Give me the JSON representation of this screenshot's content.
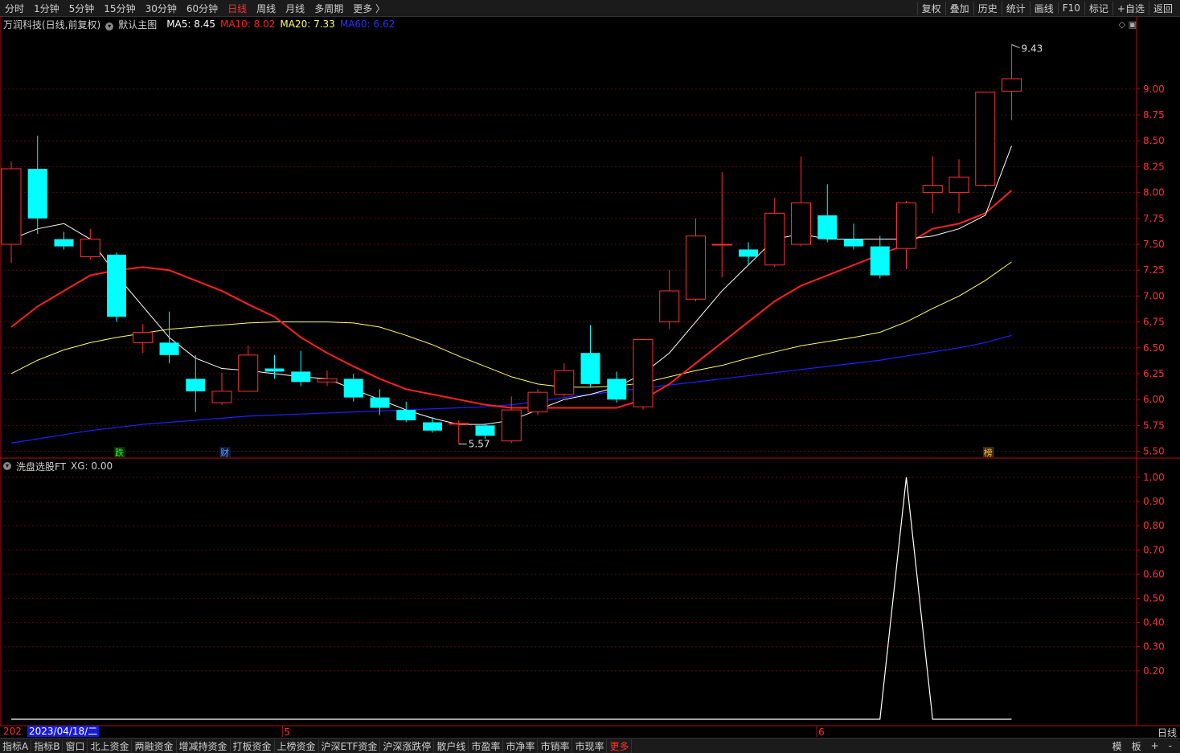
{
  "topbar": {
    "periods": [
      "分时",
      "1分钟",
      "5分钟",
      "15分钟",
      "30分钟",
      "60分钟",
      "日线",
      "周线",
      "月线",
      "多周期",
      "更多 〉"
    ],
    "active_period": "日线",
    "tools": [
      "复权",
      "叠加",
      "历史",
      "统计",
      "画线",
      "F10",
      "标记",
      "+自选",
      "返回"
    ]
  },
  "info": {
    "stock": "万润科技(日线,前复权)",
    "main_chart": "默认主图",
    "ma5": "MA5: 8.45",
    "ma10": "MA10: 8.02",
    "ma20": "MA20: 7.33",
    "ma60": "MA60: 6.62",
    "colors": {
      "ma5": "#ffffff",
      "ma10": "#ff2020",
      "ma20": "#ffff66",
      "ma60": "#2020ff",
      "up": "#ff3030",
      "down": "#00ffff"
    }
  },
  "sub": {
    "title": "洗盘选股FT",
    "xg": "XG: 0.00"
  },
  "markers": {
    "die": "跌",
    "cai": "财",
    "bang": "榜"
  },
  "chart_data": {
    "type": "candlestick",
    "price_axis": [
      9.0,
      8.75,
      8.5,
      8.25,
      8.0,
      7.75,
      7.5,
      7.25,
      7.0,
      6.75,
      6.5,
      6.25,
      6.0,
      5.75,
      5.5
    ],
    "ylim": [
      5.45,
      9.55
    ],
    "high_label": "9.43",
    "low_label": "5.57",
    "candles": [
      {
        "o": 7.5,
        "c": 8.23,
        "h": 8.3,
        "l": 7.32
      },
      {
        "o": 8.23,
        "c": 7.75,
        "h": 8.55,
        "l": 7.6
      },
      {
        "o": 7.55,
        "c": 7.48,
        "h": 7.62,
        "l": 7.45
      },
      {
        "o": 7.38,
        "c": 7.55,
        "h": 7.65,
        "l": 7.35
      },
      {
        "o": 7.4,
        "c": 6.8,
        "h": 7.42,
        "l": 6.75
      },
      {
        "o": 6.55,
        "c": 6.65,
        "h": 6.73,
        "l": 6.45
      },
      {
        "o": 6.55,
        "c": 6.43,
        "h": 6.85,
        "l": 6.35
      },
      {
        "o": 6.2,
        "c": 6.08,
        "h": 6.43,
        "l": 5.88
      },
      {
        "o": 5.97,
        "c": 6.08,
        "h": 6.26,
        "l": 5.95
      },
      {
        "o": 6.08,
        "c": 6.43,
        "h": 6.52,
        "l": 6.08
      },
      {
        "o": 6.3,
        "c": 6.27,
        "h": 6.43,
        "l": 6.2
      },
      {
        "o": 6.27,
        "c": 6.17,
        "h": 6.47,
        "l": 6.13
      },
      {
        "o": 6.17,
        "c": 6.2,
        "h": 6.28,
        "l": 6.13
      },
      {
        "o": 6.2,
        "c": 6.02,
        "h": 6.25,
        "l": 5.98
      },
      {
        "o": 6.02,
        "c": 5.92,
        "h": 6.1,
        "l": 5.85
      },
      {
        "o": 5.9,
        "c": 5.8,
        "h": 5.98,
        "l": 5.78
      },
      {
        "o": 5.78,
        "c": 5.7,
        "h": 5.83,
        "l": 5.68
      },
      {
        "o": 5.77,
        "c": 5.77,
        "h": 5.8,
        "l": 5.57
      },
      {
        "o": 5.75,
        "c": 5.65,
        "h": 5.77,
        "l": 5.62
      },
      {
        "o": 5.6,
        "c": 5.9,
        "h": 6.03,
        "l": 5.58
      },
      {
        "o": 5.88,
        "c": 6.07,
        "h": 6.1,
        "l": 5.85
      },
      {
        "o": 6.05,
        "c": 6.28,
        "h": 6.35,
        "l": 6.03
      },
      {
        "o": 6.45,
        "c": 6.15,
        "h": 6.72,
        "l": 6.12
      },
      {
        "o": 6.2,
        "c": 6.0,
        "h": 6.27,
        "l": 5.97
      },
      {
        "o": 5.93,
        "c": 6.58,
        "h": 6.58,
        "l": 5.9
      },
      {
        "o": 6.75,
        "c": 7.05,
        "h": 7.25,
        "l": 6.68
      },
      {
        "o": 6.97,
        "c": 7.58,
        "h": 7.75,
        "l": 6.95
      },
      {
        "o": 7.5,
        "c": 7.5,
        "h": 8.2,
        "l": 7.18
      },
      {
        "o": 7.45,
        "c": 7.38,
        "h": 7.52,
        "l": 7.3
      },
      {
        "o": 7.3,
        "c": 7.8,
        "h": 7.95,
        "l": 7.28
      },
      {
        "o": 7.5,
        "c": 7.9,
        "h": 8.35,
        "l": 7.48
      },
      {
        "o": 7.78,
        "c": 7.55,
        "h": 8.08,
        "l": 7.52
      },
      {
        "o": 7.55,
        "c": 7.48,
        "h": 7.7,
        "l": 7.45
      },
      {
        "o": 7.48,
        "c": 7.2,
        "h": 7.58,
        "l": 7.17
      },
      {
        "o": 7.46,
        "c": 7.9,
        "h": 7.92,
        "l": 7.26
      },
      {
        "o": 8.0,
        "c": 8.07,
        "h": 8.35,
        "l": 7.8
      },
      {
        "o": 8.0,
        "c": 8.15,
        "h": 8.32,
        "l": 7.8
      },
      {
        "o": 8.07,
        "c": 8.97,
        "h": 8.97,
        "l": 8.05
      },
      {
        "o": 8.98,
        "c": 9.1,
        "h": 9.43,
        "l": 8.7
      }
    ],
    "ma5": [
      7.55,
      7.65,
      7.7,
      7.55,
      7.2,
      6.9,
      6.6,
      6.4,
      6.3,
      6.28,
      6.25,
      6.22,
      6.2,
      6.1,
      6.0,
      5.9,
      5.82,
      5.76,
      5.76,
      5.8,
      5.9,
      6.0,
      6.05,
      6.12,
      6.25,
      6.45,
      6.75,
      7.05,
      7.3,
      7.55,
      7.6,
      7.55,
      7.55,
      7.55,
      7.55,
      7.58,
      7.65,
      7.78,
      8.45
    ],
    "ma10": [
      6.7,
      6.9,
      7.05,
      7.2,
      7.25,
      7.28,
      7.25,
      7.15,
      7.05,
      6.92,
      6.8,
      6.6,
      6.45,
      6.32,
      6.2,
      6.1,
      6.05,
      6.0,
      5.95,
      5.92,
      5.92,
      5.92,
      5.92,
      5.92,
      6.0,
      6.15,
      6.35,
      6.55,
      6.75,
      6.95,
      7.1,
      7.2,
      7.3,
      7.4,
      7.5,
      7.65,
      7.7,
      7.8,
      8.02
    ],
    "ma20": [
      6.25,
      6.38,
      6.48,
      6.55,
      6.6,
      6.64,
      6.68,
      6.7,
      6.72,
      6.74,
      6.75,
      6.75,
      6.75,
      6.74,
      6.7,
      6.62,
      6.53,
      6.42,
      6.32,
      6.22,
      6.15,
      6.12,
      6.12,
      6.13,
      6.16,
      6.22,
      6.28,
      6.33,
      6.4,
      6.46,
      6.52,
      6.56,
      6.6,
      6.65,
      6.75,
      6.88,
      7.0,
      7.15,
      7.33
    ],
    "ma60": [
      5.58,
      5.62,
      5.66,
      5.7,
      5.73,
      5.76,
      5.78,
      5.8,
      5.82,
      5.84,
      5.85,
      5.86,
      5.87,
      5.88,
      5.89,
      5.9,
      5.91,
      5.92,
      5.93,
      5.95,
      5.98,
      6.02,
      6.05,
      6.08,
      6.11,
      6.14,
      6.17,
      6.2,
      6.23,
      6.26,
      6.29,
      6.32,
      6.35,
      6.38,
      6.42,
      6.46,
      6.5,
      6.55,
      6.62
    ],
    "sub_axis": [
      1.0,
      0.9,
      0.8,
      0.7,
      0.6,
      0.5,
      0.4,
      0.3,
      0.2
    ],
    "sub_ylim": [
      0,
      1.0
    ],
    "xg": [
      0,
      0,
      0,
      0,
      0,
      0,
      0,
      0,
      0,
      0,
      0,
      0,
      0,
      0,
      0,
      0,
      0,
      0,
      0,
      0,
      0,
      0,
      0,
      0,
      0,
      0,
      0,
      0,
      0,
      0,
      0,
      0,
      0,
      0,
      1,
      0,
      0,
      0,
      0
    ],
    "x_labels": [
      {
        "index": 10.3,
        "text": "5"
      },
      {
        "index": 30.6,
        "text": "6"
      }
    ]
  },
  "bottom": {
    "tabs": [
      "指标A",
      "指标B",
      "窗口",
      "北上资金",
      "两融资金",
      "增减持资金",
      "打板资金",
      "上榜资金",
      "沪深ETF资金",
      "沪深涨跌停",
      "散户线",
      "市盈率",
      "市净率",
      "市销率",
      "市现率",
      "更多"
    ],
    "right": [
      "模",
      "板",
      "+",
      "-"
    ],
    "date_prefix": "202",
    "cursor_date": "2023/04/18/二",
    "axis_tag": "日线"
  }
}
